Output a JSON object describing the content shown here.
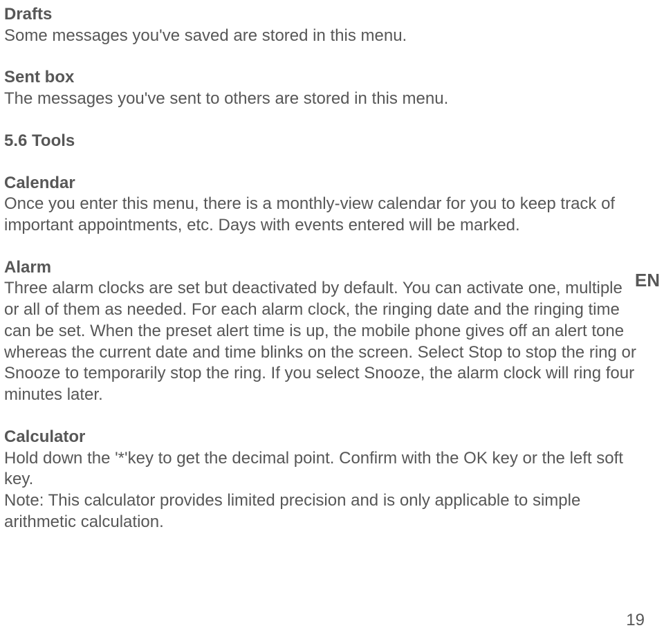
{
  "drafts": {
    "heading": "Drafts",
    "body": "Some messages you've saved are stored in this menu."
  },
  "sentbox": {
    "heading": "Sent box",
    "body": "The messages you've sent to others are stored in this menu."
  },
  "tools": {
    "heading": "5.6 Tools"
  },
  "calendar": {
    "heading": "Calendar",
    "body": "Once you enter this menu, there is a monthly-view calendar for you to keep track of important appointments, etc. Days with events entered will be marked."
  },
  "alarm": {
    "heading": "Alarm",
    "body": "Three alarm clocks are set but deactivated by default. You can activate one, multiple or all of them as needed. For each alarm clock, the ringing date and the ringing time can be set. When the preset alert time is up, the mobile phone gives off an alert tone whereas the current date and time blinks on the screen. Select Stop to stop the ring or Snooze to temporarily stop the ring. If you select Snooze, the alarm clock will ring four minutes later."
  },
  "calculator": {
    "heading": "Calculator",
    "body1": "Hold down the '*'key to get the decimal point. Confirm with the OK key or the left soft key.",
    "body2": "Note: This calculator provides limited precision and is only applicable to simple arithmetic calculation."
  },
  "langTag": "EN",
  "pageNumber": "19"
}
